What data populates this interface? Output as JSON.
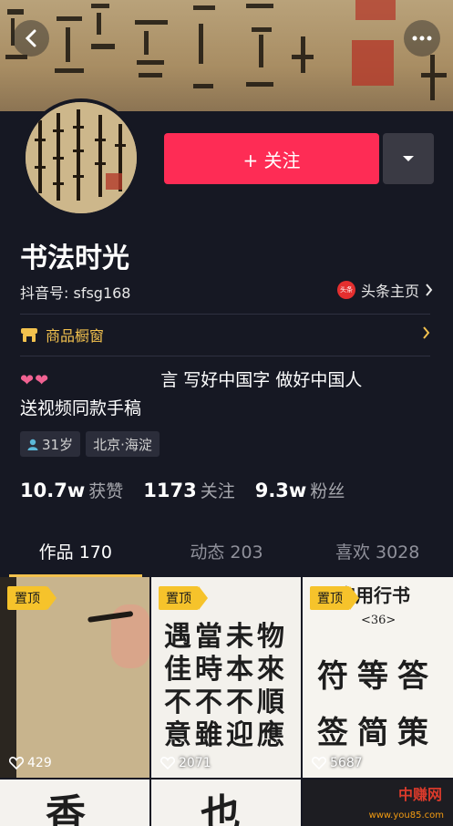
{
  "profile": {
    "nickname": "书法时光",
    "douyin_id": "抖音号: sfsg168",
    "toutiao_link": "头条主页",
    "toutiao_badge": "头条",
    "follow_label": "+ 关注",
    "shop_label": "商品橱窗",
    "bio_hearts": "❤❤",
    "bio_line1": "言 写好中国字 做好中国人",
    "bio_line2": "送视频同款手稿",
    "tags": [
      "31岁",
      "北京·海淀"
    ]
  },
  "stats": [
    {
      "num": "10.7w",
      "label": "获赞"
    },
    {
      "num": "1173",
      "label": "关注"
    },
    {
      "num": "9.3w",
      "label": "粉丝"
    }
  ],
  "tabs": [
    {
      "label": "作品 170"
    },
    {
      "label": "动态 203"
    },
    {
      "label": "喜欢 3028"
    }
  ],
  "videos": [
    {
      "pin": "置顶",
      "likes": "429"
    },
    {
      "pin": "置顶",
      "likes": "2071"
    },
    {
      "pin": "置顶",
      "likes": "5687"
    }
  ],
  "video_art": {
    "v2": [
      "遇",
      "當",
      "未",
      "物",
      "佳",
      "時",
      "本",
      "來",
      "不",
      "不",
      "不",
      "順",
      "意",
      "雖",
      "迎",
      "應"
    ],
    "v3_title": "实用行书",
    "v3_sub": "<36>",
    "v3_chars": [
      "符",
      "等",
      "答",
      "签",
      "简",
      "策"
    ],
    "row2": [
      "香",
      "也"
    ]
  },
  "watermark": {
    "title": "中赚网",
    "url": "www.you85.com"
  },
  "colors": {
    "accent_red": "#fe2c55",
    "pin_yellow": "#f6c32b",
    "bg": "#161823"
  }
}
